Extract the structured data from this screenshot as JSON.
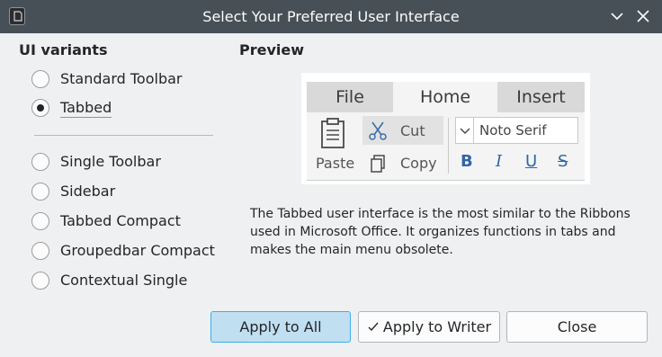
{
  "window": {
    "title": "Select Your Preferred User Interface",
    "icon": "app-document-icon",
    "controls": [
      "minimize-chevron-icon",
      "close-icon"
    ]
  },
  "variants": {
    "heading": "UI variants",
    "options": [
      {
        "label": "Standard Toolbar",
        "checked": false
      },
      {
        "label": "Tabbed",
        "checked": true
      },
      {
        "label": "Single Toolbar",
        "checked": false
      },
      {
        "label": "Sidebar",
        "checked": false
      },
      {
        "label": "Tabbed Compact",
        "checked": false
      },
      {
        "label": "Groupedbar Compact",
        "checked": false
      },
      {
        "label": "Contextual Single",
        "checked": false
      }
    ]
  },
  "preview": {
    "heading": "Preview",
    "tabs": [
      "File",
      "Home",
      "Insert"
    ],
    "active_tab": "Home",
    "paste_label": "Paste",
    "cut_label": "Cut",
    "copy_label": "Copy",
    "font_name": "Noto Serif",
    "format_buttons": [
      "B",
      "I",
      "U",
      "S"
    ]
  },
  "description": "The Tabbed user interface is the most similar to the Ribbons used in Microsoft Office. It organizes functions in tabs and makes the main menu obsolete.",
  "buttons": {
    "apply_all": "Apply to All",
    "apply_writer": "Apply to Writer",
    "close": "Close"
  },
  "colors": {
    "titlebar": "#475057",
    "accent": "#3daee9",
    "primary_button": "#c0dff1",
    "format_blue": "#2f66a8"
  }
}
